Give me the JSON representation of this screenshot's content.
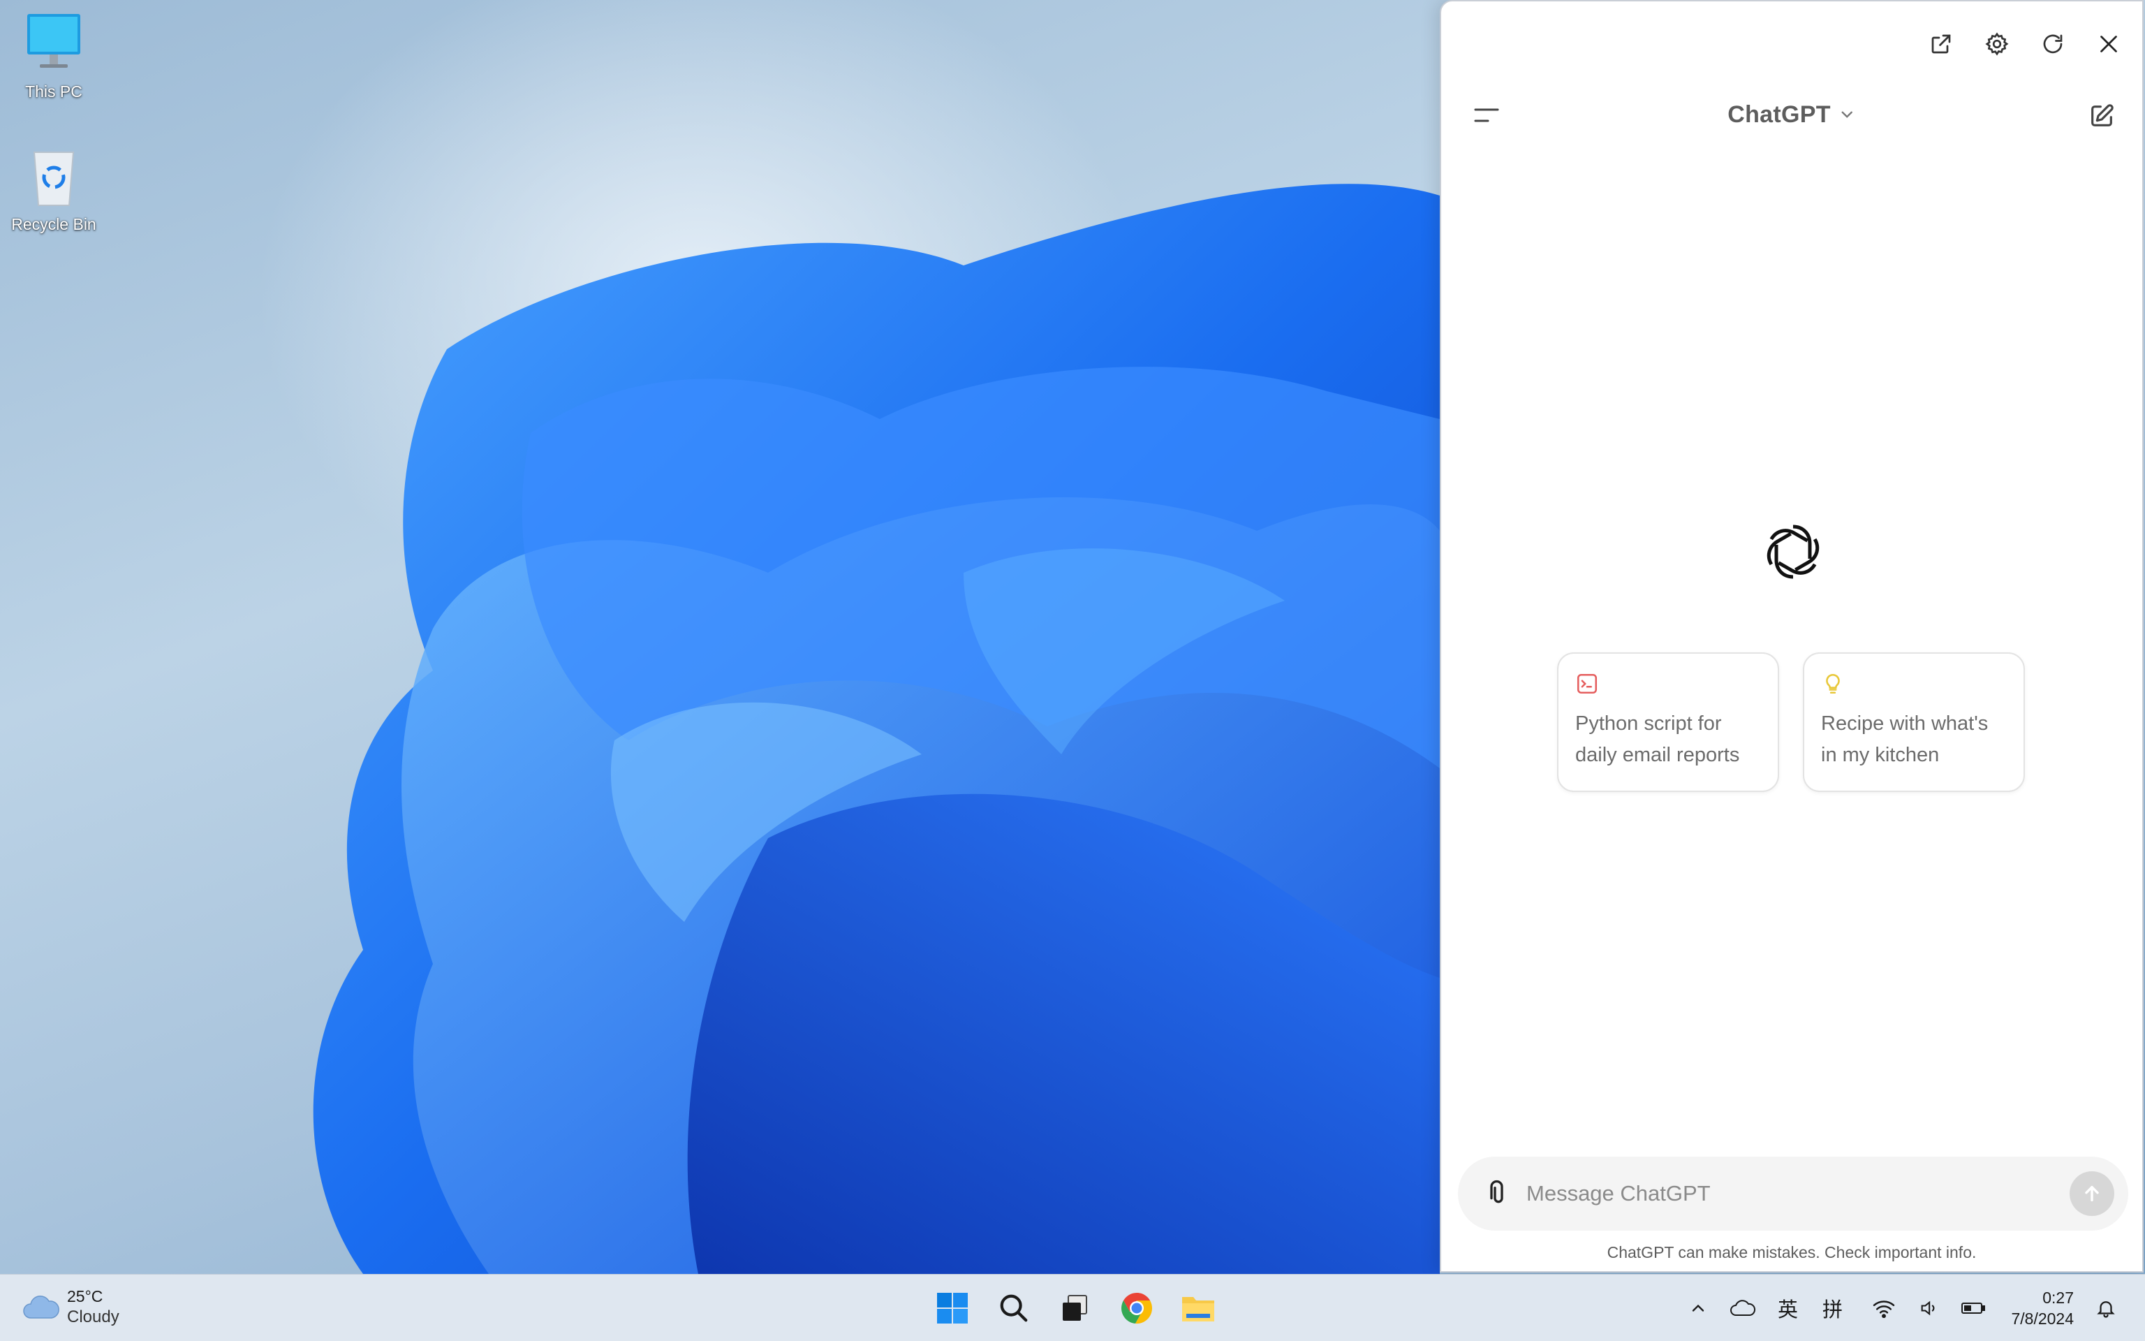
{
  "desktop": {
    "icons": [
      {
        "label": "This PC",
        "icon": "monitor-icon"
      },
      {
        "label": "Recycle Bin",
        "icon": "recycle-bin-icon"
      }
    ]
  },
  "chat_window": {
    "controls": {
      "popout": "popout-icon",
      "settings": "gear-icon",
      "refresh": "refresh-icon",
      "close": "close-icon"
    },
    "header": {
      "model_name": "ChatGPT",
      "menu_icon": "sidebar-menu-icon",
      "new_chat_icon": "compose-icon"
    },
    "logo": "openai-logo",
    "suggestions": [
      {
        "text": "Python script for daily email reports",
        "icon": "terminal-icon",
        "icon_color": "#e55e5e"
      },
      {
        "text": "Recipe with what's in my kitchen",
        "icon": "lightbulb-icon",
        "icon_color": "#e8c83a"
      }
    ],
    "composer": {
      "placeholder": "Message ChatGPT",
      "attach_icon": "paperclip-icon",
      "send_icon": "arrow-up-icon"
    },
    "disclaimer": "ChatGPT can make mistakes. Check important info."
  },
  "taskbar": {
    "weather": {
      "temperature": "25°C",
      "condition": "Cloudy",
      "icon": "cloud-icon"
    },
    "apps": [
      {
        "name": "Start",
        "icon": "windows-start-icon"
      },
      {
        "name": "Search",
        "icon": "search-icon"
      },
      {
        "name": "Task View",
        "icon": "task-view-icon"
      },
      {
        "name": "Chrome",
        "icon": "chrome-icon"
      },
      {
        "name": "File Explorer",
        "icon": "file-explorer-icon"
      }
    ],
    "tray": {
      "ime_lang": "英",
      "ime_mode": "拼",
      "time": "0:27",
      "date": "7/8/2024"
    }
  },
  "colors": {
    "accent": "#0078d4",
    "card_border": "#e3e3e3",
    "composer_bg": "#f4f4f4",
    "taskbar_bg": "#dfe7f0"
  }
}
